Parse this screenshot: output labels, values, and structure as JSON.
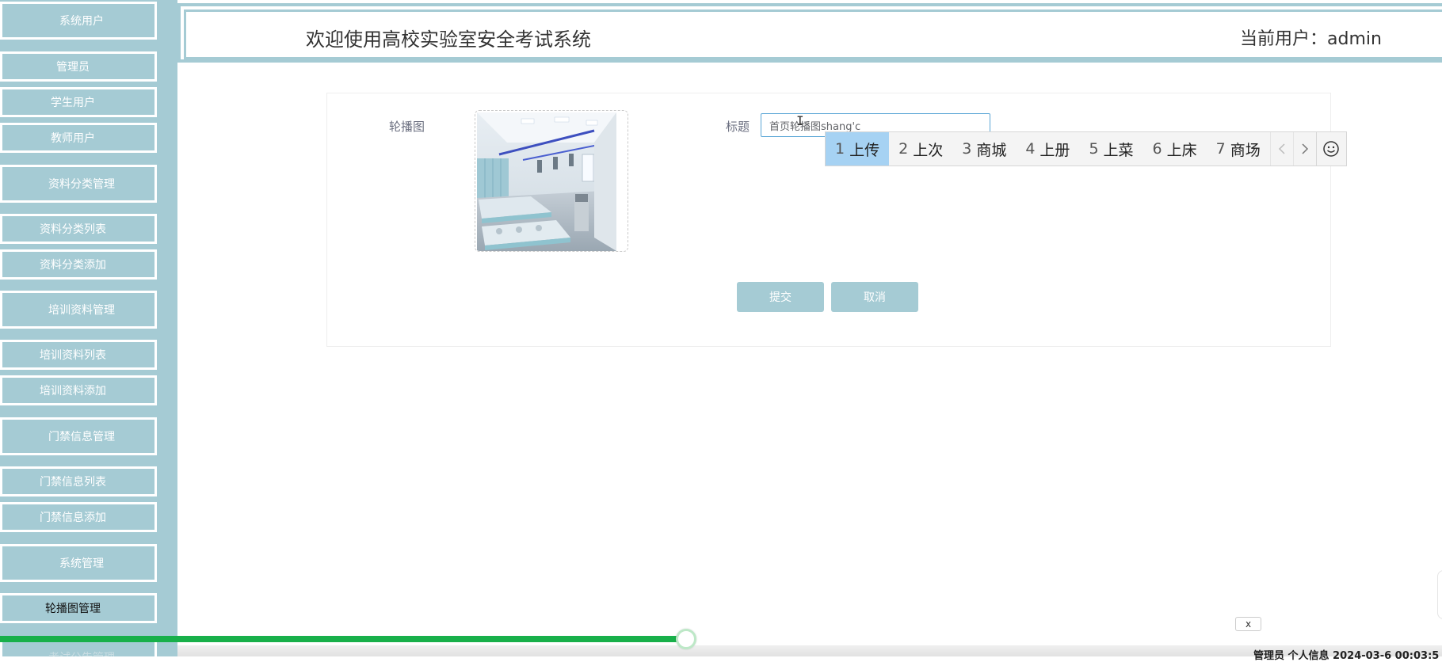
{
  "header": {
    "title": "欢迎使用高校实验室安全考试系统",
    "current_user": "当前用户：admin"
  },
  "sidebar": {
    "items": [
      {
        "label": "系统用户",
        "kind": "group"
      },
      {
        "label": "管理员",
        "kind": "sub"
      },
      {
        "label": "学生用户",
        "kind": "sub"
      },
      {
        "label": "教师用户",
        "kind": "sub"
      },
      {
        "label": "资料分类管理",
        "kind": "group"
      },
      {
        "label": "资料分类列表",
        "kind": "sub"
      },
      {
        "label": "资料分类添加",
        "kind": "sub"
      },
      {
        "label": "培训资料管理",
        "kind": "group"
      },
      {
        "label": "培训资料列表",
        "kind": "sub"
      },
      {
        "label": "培训资料添加",
        "kind": "sub"
      },
      {
        "label": "门禁信息管理",
        "kind": "group"
      },
      {
        "label": "门禁信息列表",
        "kind": "sub"
      },
      {
        "label": "门禁信息添加",
        "kind": "sub"
      },
      {
        "label": "系统管理",
        "kind": "group"
      },
      {
        "label": "轮播图管理",
        "kind": "sub",
        "active": true
      },
      {
        "label": "考试公告管理",
        "kind": "group",
        "partial": true
      }
    ]
  },
  "form": {
    "carousel_label": "轮播图",
    "title_label": "标题",
    "title_value": "首页轮播图shang'c",
    "submit_label": "提交",
    "cancel_label": "取消"
  },
  "ime": {
    "candidates": [
      {
        "num": "1",
        "text": "上传",
        "selected": true
      },
      {
        "num": "2",
        "text": "上次"
      },
      {
        "num": "3",
        "text": "商城"
      },
      {
        "num": "4",
        "text": "上册"
      },
      {
        "num": "5",
        "text": "上菜"
      },
      {
        "num": "6",
        "text": "上床"
      },
      {
        "num": "7",
        "text": "商场"
      }
    ],
    "prev_icon": "chevron-left-icon",
    "next_icon": "chevron-right-icon",
    "emoji_icon": "smiley-icon"
  },
  "video_overlay": {
    "close_label": "x",
    "progress": 0.476,
    "footer_text": "管理员  个人信息  2024-03-6 00:03:5"
  },
  "colors": {
    "accent": "#a5cbd4",
    "ime_selected": "#a6d2f3",
    "progress": "#18b04a"
  }
}
